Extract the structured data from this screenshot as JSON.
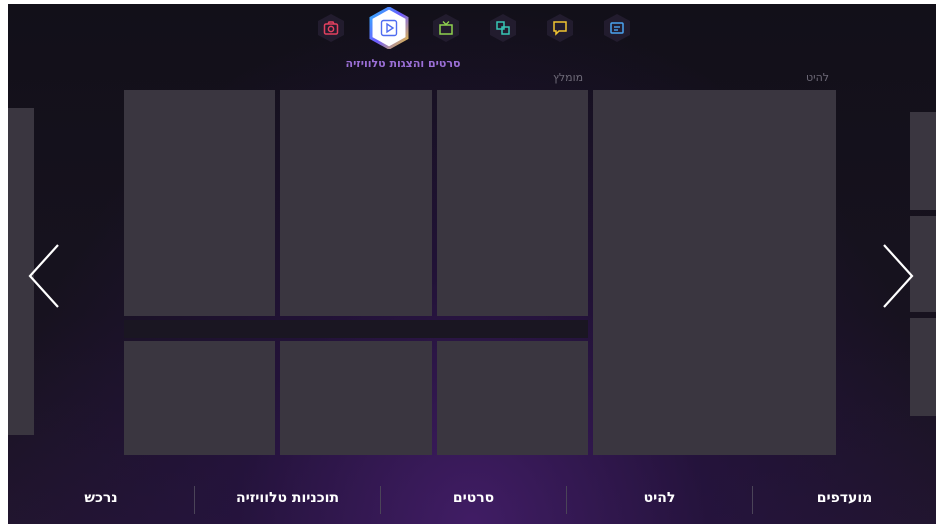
{
  "top_bar": {
    "active_label": "סרטים והצגות טלוויזיה",
    "icons": [
      {
        "name": "camera-icon",
        "color": "#e2405f"
      },
      {
        "name": "play-icon",
        "color": "#4f8cf0"
      },
      {
        "name": "tv-icon",
        "color": "#8fd14f"
      },
      {
        "name": "apps-icon",
        "color": "#37c7b6"
      },
      {
        "name": "chat-icon",
        "color": "#f2c531"
      },
      {
        "name": "guide-icon",
        "color": "#4aa3f0"
      }
    ]
  },
  "sections": {
    "hit_label": "להיט",
    "recommended_label": "מומלץ"
  },
  "bottom_nav": {
    "items": [
      "נרכש",
      "תוכניות טלוויזיה",
      "סרטים",
      "להיט",
      "מועדפים"
    ]
  }
}
